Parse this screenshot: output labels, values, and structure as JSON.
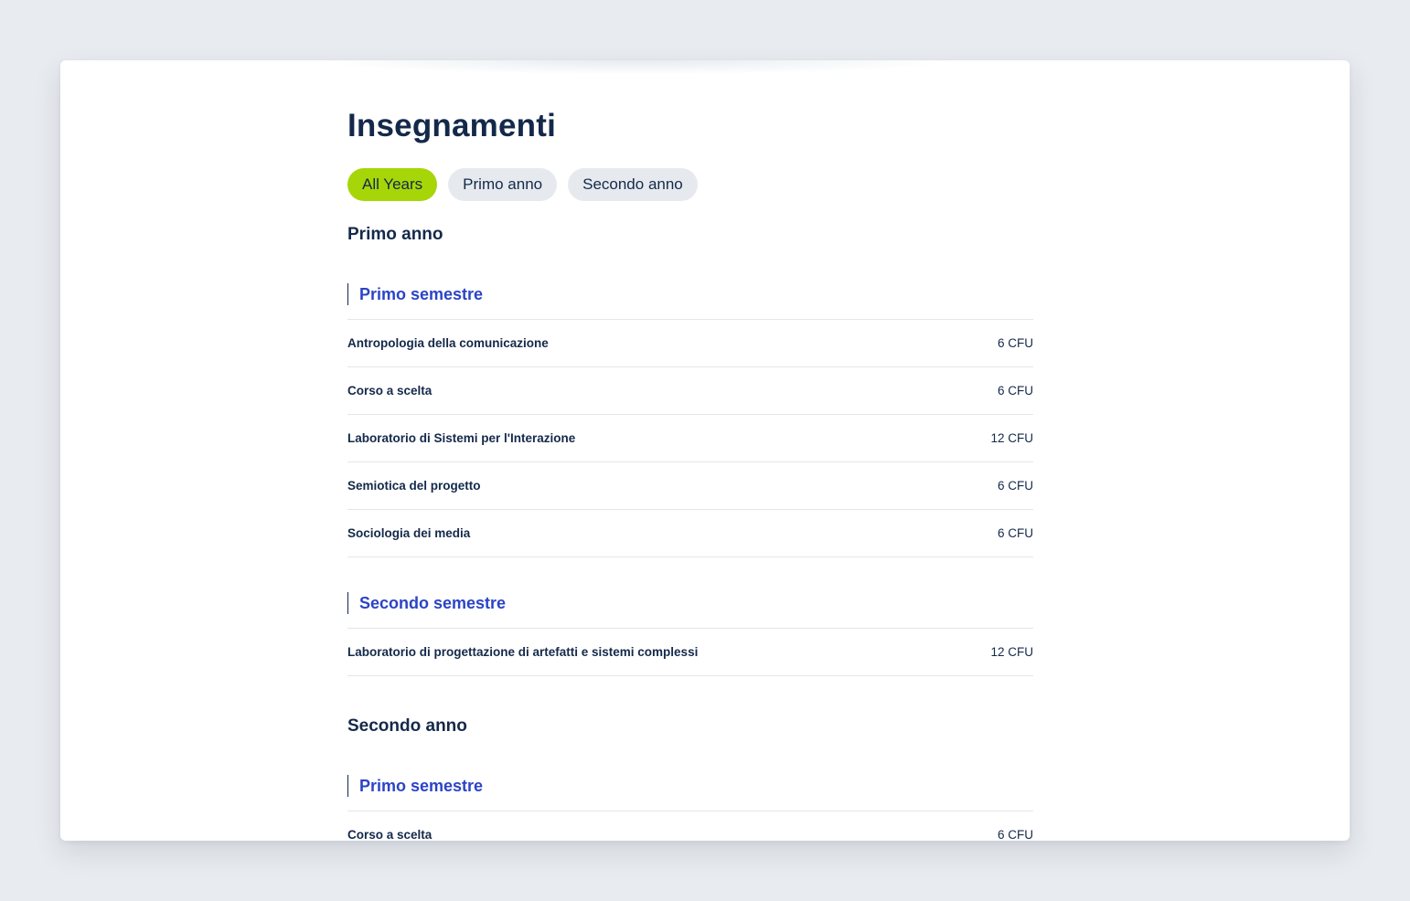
{
  "header": {
    "title": "Insegnamenti"
  },
  "filters": [
    {
      "label": "All Years",
      "active": true
    },
    {
      "label": "Primo anno",
      "active": false
    },
    {
      "label": "Secondo anno",
      "active": false
    }
  ],
  "years": [
    {
      "title": "Primo anno",
      "semesters": [
        {
          "title": "Primo semestre",
          "courses": [
            {
              "name": "Antropologia della comunicazione",
              "credits": "6 CFU"
            },
            {
              "name": "Corso a scelta",
              "credits": "6 CFU"
            },
            {
              "name": "Laboratorio di Sistemi per l'Interazione",
              "credits": "12 CFU"
            },
            {
              "name": "Semiotica del progetto",
              "credits": "6 CFU"
            },
            {
              "name": "Sociologia dei media",
              "credits": "6 CFU"
            }
          ]
        },
        {
          "title": "Secondo semestre",
          "courses": [
            {
              "name": "Laboratorio di progettazione di artefatti e sistemi complessi",
              "credits": "12 CFU"
            }
          ]
        }
      ]
    },
    {
      "title": "Secondo anno",
      "semesters": [
        {
          "title": "Primo semestre",
          "courses": [
            {
              "name": "Corso a scelta",
              "credits": "6 CFU"
            }
          ]
        }
      ]
    }
  ],
  "colors": {
    "active_chip": "#a6d608",
    "inactive_chip": "#e6eaee",
    "semester_title": "#2b44c7",
    "text": "#14294a"
  }
}
